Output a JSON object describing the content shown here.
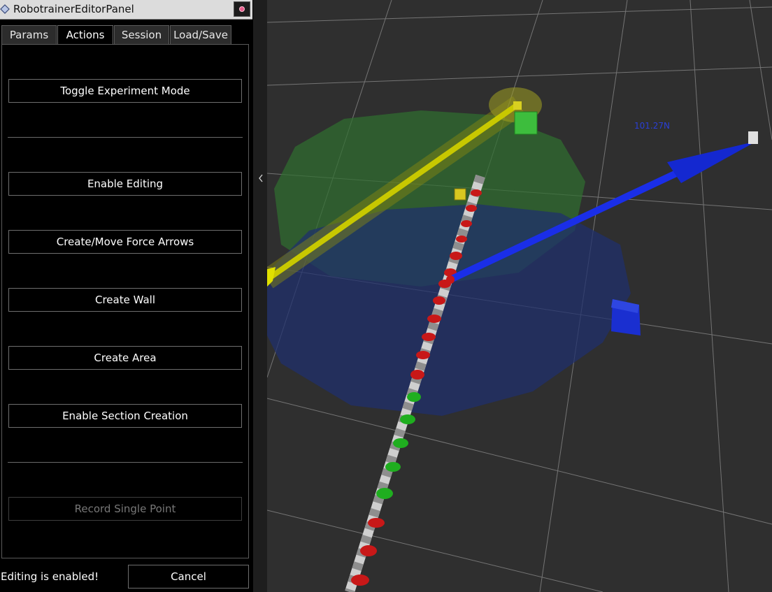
{
  "window": {
    "title": "RobotrainerEditorPanel",
    "icon": "diamond-app-icon",
    "close_icon": "close-icon"
  },
  "tabs": [
    {
      "label": "Params"
    },
    {
      "label": "Actions",
      "active": true
    },
    {
      "label": "Session"
    },
    {
      "label": "Load/Save"
    }
  ],
  "actions": {
    "toggle_experiment_mode": "Toggle Experiment Mode",
    "enable_editing": "Enable Editing",
    "create_move_force_arrows": "Create/Move Force Arrows",
    "create_wall": "Create Wall",
    "create_area": "Create Area",
    "enable_section_creation": "Enable Section Creation",
    "record_single_point": "Record Single Point"
  },
  "status": {
    "text": "Editing is enabled!",
    "cancel_label": "Cancel"
  },
  "splitter": {
    "icon": "chevron-left-icon"
  },
  "viewport": {
    "force_label": "101.27N",
    "colors": {
      "background": "#2f2f2f",
      "grid": "#8c8c8c",
      "green_area": "#2f6f2f",
      "blue_area": "#1e2f6e",
      "yellow_arrow": "#c8c800",
      "blue_arrow": "#1a2ee8"
    }
  }
}
